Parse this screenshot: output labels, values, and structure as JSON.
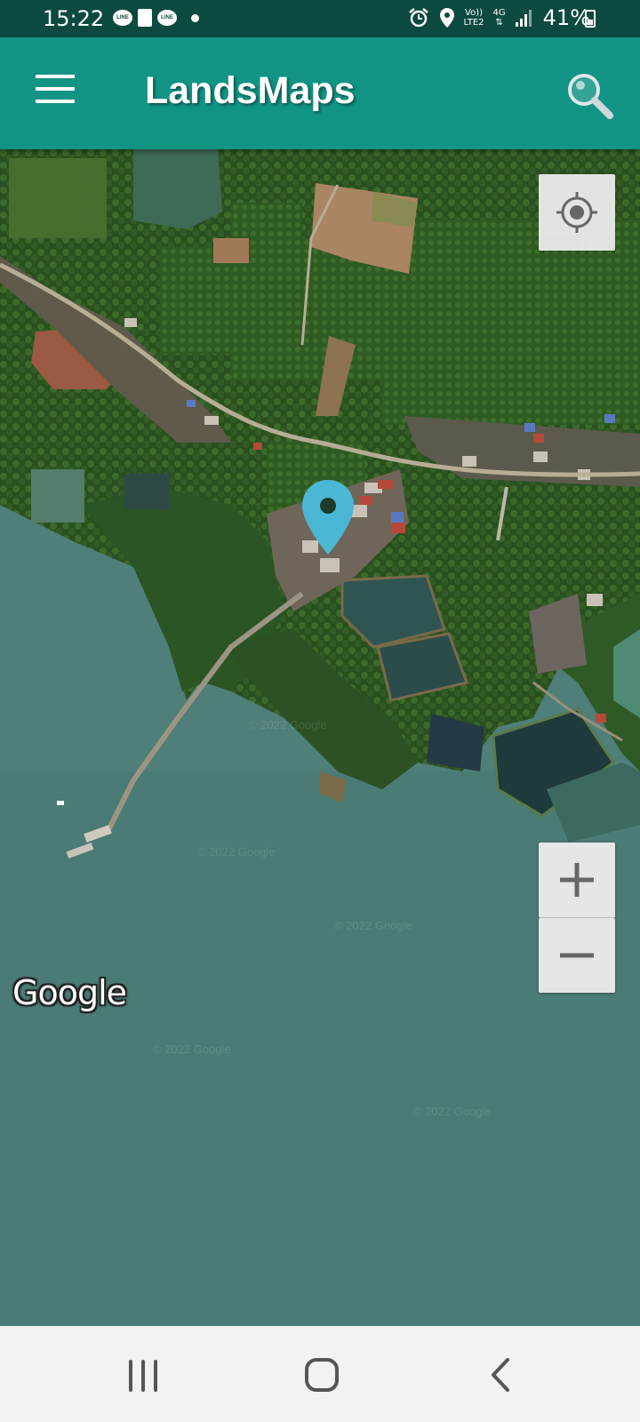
{
  "status_bar": {
    "time": "15:22",
    "notification_icons": [
      "line-icon",
      "document-icon",
      "line-icon",
      "dot-icon"
    ],
    "notif_line_label": "LINE",
    "volte_top": "Vo))",
    "volte_bottom": "LTE2",
    "network_type": "4G",
    "battery": "41%"
  },
  "app_bar": {
    "title": "LandsMaps",
    "menu_icon": "hamburger-menu-icon",
    "search_icon": "search-icon"
  },
  "map": {
    "attribution": "Google",
    "watermark": "© 2022 Google",
    "controls": {
      "locate_icon": "my-location-icon",
      "zoom_in": "+",
      "zoom_out": "−"
    },
    "marker_color": "#4ab8d4"
  },
  "nav_bar": {
    "buttons": [
      "recent-apps-icon",
      "home-icon",
      "back-icon"
    ]
  },
  "colors": {
    "app_bar": "#129485",
    "status_bar": "#0c4a3f"
  }
}
